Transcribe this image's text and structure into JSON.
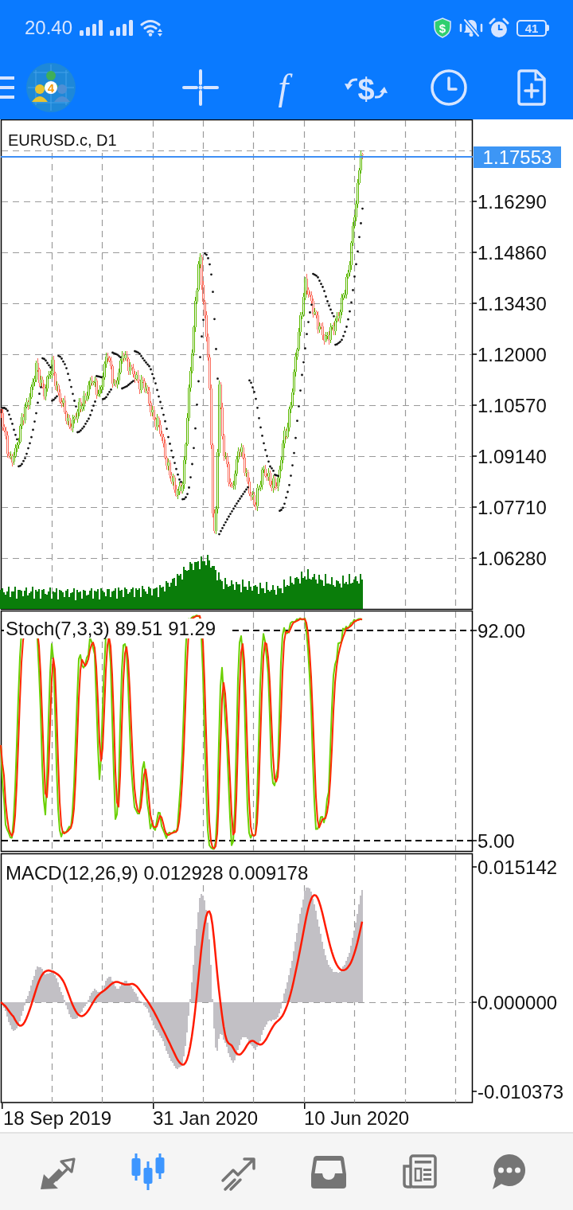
{
  "status_bar": {
    "time": "20.40",
    "shield_glyph": "$",
    "battery": "41"
  },
  "toolbar": {
    "logo_mark": "4",
    "indicator_glyph": "f",
    "currency_glyph": "$"
  },
  "chart": {
    "symbol": "EURUSD.c, D1",
    "current_price": "1.17553",
    "price_axis": [
      "1.16290",
      "1.14860",
      "1.13430",
      "1.12000",
      "1.10570",
      "1.09140",
      "1.07710",
      "1.06280"
    ],
    "stochastic": {
      "label": "Stoch(7,3,3) 89.51 91.29",
      "axis": [
        "92.00",
        "5.00"
      ]
    },
    "macd": {
      "label": "MACD(12,26,9) 0.012928 0.009178",
      "axis": [
        "0.015142",
        "0.000000",
        "-0.010373"
      ]
    },
    "time_axis": [
      "18 Sep 2019",
      "31 Jan 2020",
      "10 Jun 2020"
    ]
  },
  "bottom_nav": [
    {
      "selected": false
    },
    {
      "selected": true
    },
    {
      "selected": false
    },
    {
      "selected": false
    },
    {
      "selected": false
    },
    {
      "selected": false
    }
  ]
}
